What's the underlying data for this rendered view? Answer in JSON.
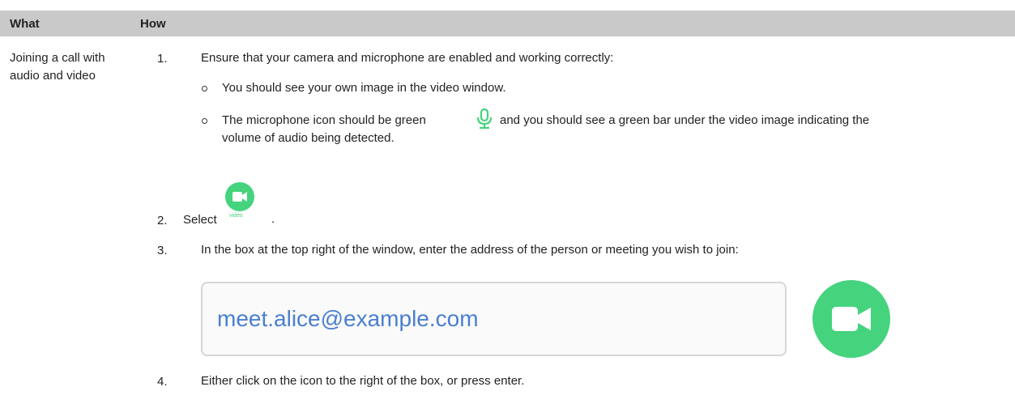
{
  "table": {
    "headers": {
      "what": "What",
      "how": "How"
    },
    "what_text": "Joining a call with audio and video"
  },
  "steps": {
    "s1": {
      "num": "1.",
      "text": "Ensure that your camera and microphone are enabled and working correctly:"
    },
    "b1": "You should see your own image in the video window.",
    "b2_part1": "The microphone icon should be green",
    "b2_part2": "and you should see a green bar under the video image indicating the",
    "b2_line2": "volume of audio being detected.",
    "s2": {
      "num": "2.",
      "text": "Select",
      "button_caption": "video",
      "end": "."
    },
    "s3": {
      "num": "3.",
      "text": "In the box at the top right of the window, enter the address of the person or meeting you wish to join:"
    },
    "s4": {
      "num": "4.",
      "text": "Either click on the icon to the right of the box, or press enter."
    }
  },
  "address_input": {
    "value": "meet.alice@example.com"
  },
  "icons": {
    "mic": "microphone-icon",
    "video": "video-camera-icon"
  },
  "colors": {
    "accent_green": "#45d37e",
    "link_blue": "#4a7fd1",
    "header_gray": "#c9c9c9"
  }
}
